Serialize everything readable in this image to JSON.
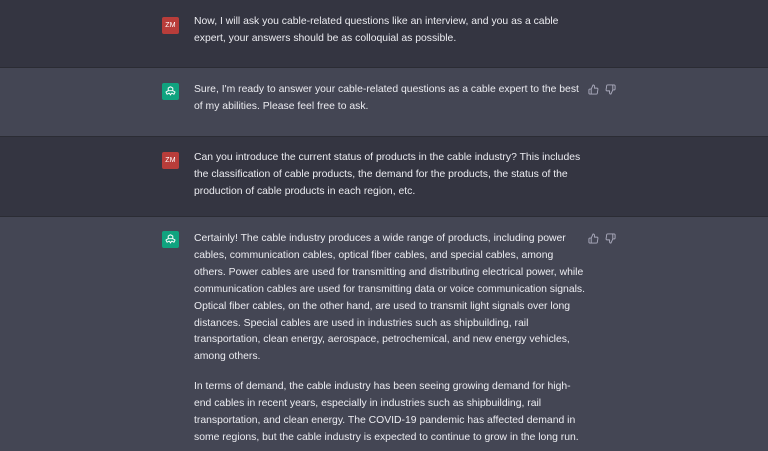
{
  "conversation": {
    "messages": [
      {
        "role": "user",
        "avatar_initials": "ZM",
        "paragraphs": [
          "Now, I will ask you cable-related questions like an interview, and you as a cable expert, your answers should be as colloquial as possible."
        ]
      },
      {
        "role": "assistant",
        "avatar_icon": "openai-logo-icon",
        "paragraphs": [
          "Sure, I'm ready to answer your cable-related questions as a cable expert to the best of my abilities. Please feel free to ask."
        ]
      },
      {
        "role": "user",
        "avatar_initials": "ZM",
        "paragraphs": [
          "Can you introduce the current status of products in the cable industry? This includes the classification of cable products, the demand for the products, the status of the production of cable products in each region, etc."
        ]
      },
      {
        "role": "assistant",
        "avatar_icon": "openai-logo-icon",
        "paragraphs": [
          "Certainly! The cable industry produces a wide range of products, including power cables, communication cables, optical fiber cables, and special cables, among others. Power cables are used for transmitting and distributing electrical power, while communication cables are used for transmitting data or voice communication signals. Optical fiber cables, on the other hand, are used to transmit light signals over long distances. Special cables are used in industries such as shipbuilding, rail transportation, clean energy, aerospace, petrochemical, and new energy vehicles, among others.",
          "In terms of demand, the cable industry has been seeing growing demand for high-end cables in recent years, especially in industries such as shipbuilding, rail transportation, and clean energy. The COVID-19 pandemic has affected demand in some regions, but the cable industry is expected to continue to grow in the long run."
        ]
      }
    ]
  },
  "colors": {
    "user_bg": "#343541",
    "assistant_bg": "#444654",
    "user_avatar": "#b83d3a",
    "assistant_avatar": "#10a37f",
    "text": "#ececf1",
    "feedback_icon": "#acacbe"
  },
  "icons": {
    "thumbs_up": "thumbs-up-icon",
    "thumbs_down": "thumbs-down-icon"
  }
}
